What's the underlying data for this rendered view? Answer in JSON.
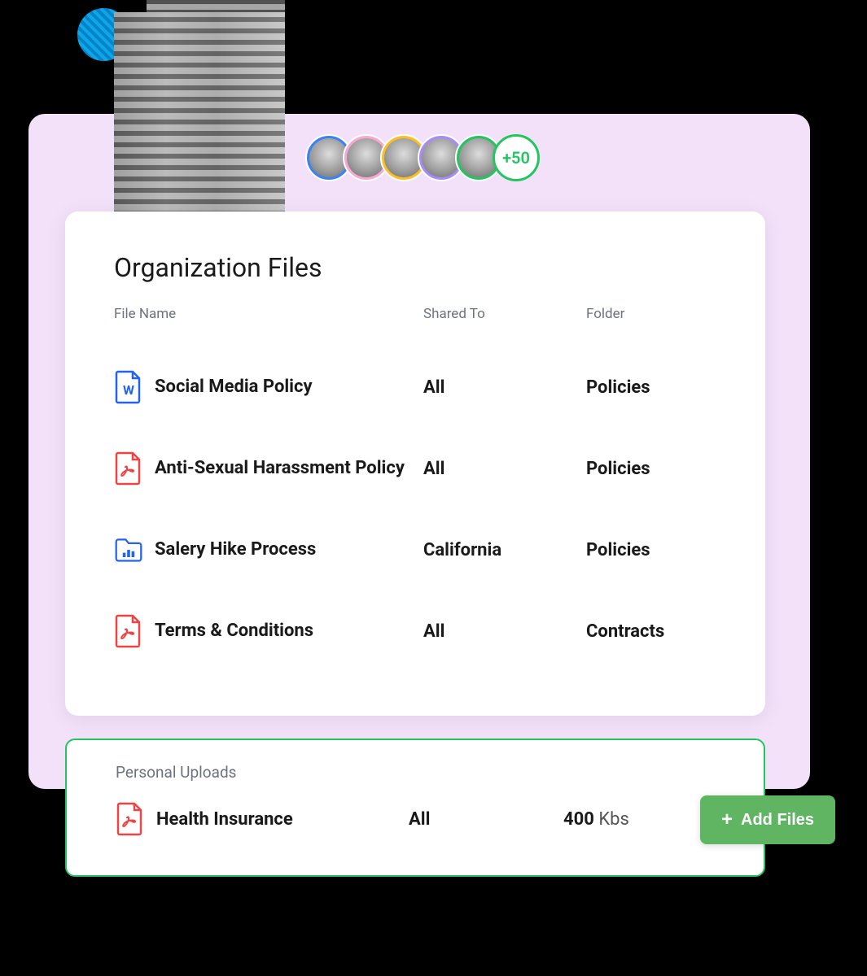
{
  "avatars": {
    "colors": [
      "#3b82f6",
      "#f9a8d4",
      "#fbbf24",
      "#a78bfa",
      "#22c55e"
    ],
    "overflow_count": "+50"
  },
  "org_files": {
    "title": "Organization Files",
    "columns": {
      "file_name": "File Name",
      "shared_to": "Shared To",
      "folder": "Folder"
    },
    "rows": [
      {
        "icon": "word",
        "name": "Social Media Policy",
        "shared_to": "All",
        "folder": "Policies"
      },
      {
        "icon": "pdf",
        "name": "Anti-Sexual Harassment Policy",
        "shared_to": "All",
        "folder": "Policies"
      },
      {
        "icon": "folder-chart",
        "name": "Salery Hike Process",
        "shared_to": "California",
        "folder": "Policies"
      },
      {
        "icon": "pdf",
        "name": "Terms & Conditions",
        "shared_to": "All",
        "folder": "Contracts"
      }
    ]
  },
  "personal": {
    "title": "Personal Uploads",
    "row": {
      "icon": "pdf",
      "name": "Health Insurance",
      "shared_to": "All",
      "size_value": "400",
      "size_unit": "Kbs"
    }
  },
  "buttons": {
    "add_files": "Add Files"
  }
}
